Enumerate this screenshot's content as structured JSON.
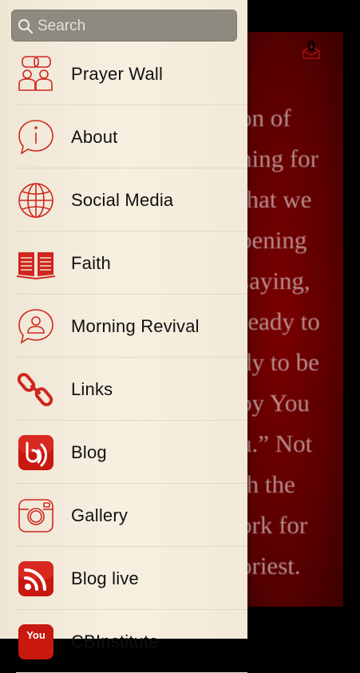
{
  "background": {
    "text_lines": [
      "on of",
      "hing for",
      "that we",
      "pening",
      "saying,",
      "ready to",
      "dy to be",
      "by You",
      "u.” Not",
      "th the",
      "ork for",
      "oriest."
    ],
    "badge_count": "0"
  },
  "search": {
    "placeholder": "Search"
  },
  "menu": [
    {
      "label": "Prayer Wall",
      "icon": "prayer-wall-icon"
    },
    {
      "label": "About",
      "icon": "info-icon"
    },
    {
      "label": "Social Media",
      "icon": "globe-icon"
    },
    {
      "label": "Faith",
      "icon": "book-icon"
    },
    {
      "label": "Morning Revival",
      "icon": "person-bubble-icon"
    },
    {
      "label": "Links",
      "icon": "link-icon"
    },
    {
      "label": "Blog",
      "icon": "blog-icon"
    },
    {
      "label": "Gallery",
      "icon": "camera-icon"
    },
    {
      "label": "Blog live",
      "icon": "rss-icon"
    },
    {
      "label": "CBInstitute",
      "icon": "youtube-icon"
    }
  ],
  "colors": {
    "accent": "#d0261d",
    "drawer_bg": "#f5ecdc",
    "search_bg": "#8f8a80",
    "content_bg": "#5a0000"
  }
}
